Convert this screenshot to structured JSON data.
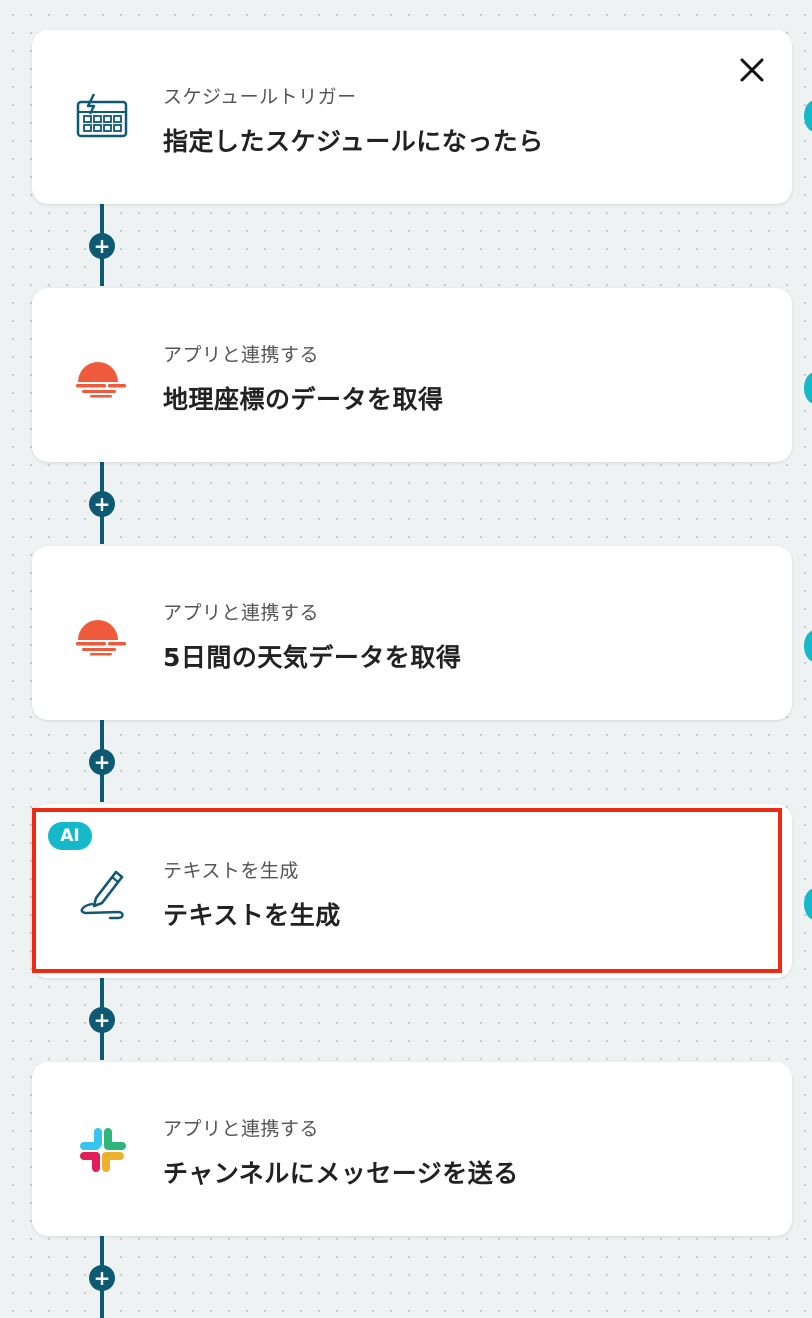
{
  "steps": [
    {
      "subtitle": "スケジュールトリガー",
      "title": "指定したスケジュールになったら",
      "icon": "schedule-calendar-icon"
    },
    {
      "subtitle": "アプリと連携する",
      "title": "地理座標のデータを取得",
      "icon": "weather-sun-icon"
    },
    {
      "subtitle": "アプリと連携する",
      "title": "5日間の天気データを取得",
      "icon": "weather-sun-icon"
    },
    {
      "subtitle": "テキストを生成",
      "title": "テキストを生成",
      "icon": "pen-icon",
      "badge": "AI"
    },
    {
      "subtitle": "アプリと連携する",
      "title": "チャンネルにメッセージを送る",
      "icon": "slack-icon"
    }
  ],
  "plus_label": "+",
  "colors": {
    "connector": "#0d5a72",
    "accent": "#16b9c9",
    "weather": "#ef5a3c",
    "highlight": "#ef2a12"
  }
}
